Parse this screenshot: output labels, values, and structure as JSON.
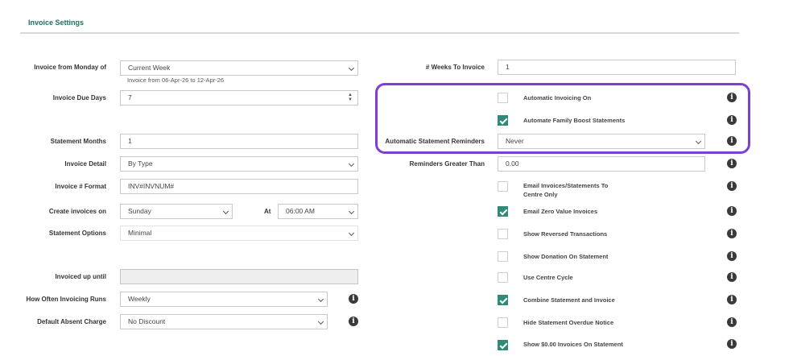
{
  "section": {
    "title": "Invoice Settings"
  },
  "left": {
    "invoice_from_label": "Invoice from Monday of",
    "invoice_from_value": "Current Week",
    "invoice_from_hint": "Invoice from 06-Apr-26 to 12-Apr-26",
    "due_days_label": "Invoice Due Days",
    "due_days_value": "7",
    "statement_months_label": "Statement Months",
    "statement_months_value": "1",
    "invoice_detail_label": "Invoice Detail",
    "invoice_detail_value": "By Type",
    "invoice_format_label": "Invoice # Format",
    "invoice_format_value": "INV#INVNUM#",
    "create_on_label": "Create invoices on",
    "create_on_value": "Sunday",
    "at_label": "At",
    "at_value": "06:00 AM",
    "statement_options_label": "Statement Options",
    "statement_options_value": "Minimal",
    "invoiced_upto_label": "Invoiced up until",
    "invoiced_upto_value": "",
    "how_often_label": "How Often Invoicing Runs",
    "how_often_value": "Weekly",
    "absent_charge_label": "Default Absent Charge",
    "absent_charge_value": "No Discount"
  },
  "right": {
    "weeks_label": "# Weeks To Invoice",
    "weeks_value": "1",
    "reminders_label": "Automatic Statement Reminders",
    "reminders_value": "Never",
    "reminders_gt_label": "Reminders Greater Than",
    "reminders_gt_value": "0.00",
    "checkboxes": [
      {
        "label": "Automatic Invoicing On",
        "checked": false
      },
      {
        "label": "Automate Family Boost Statements",
        "checked": true
      },
      {
        "label": "Email Invoices/Statements To Centre Only",
        "checked": false
      },
      {
        "label": "Email Zero Value Invoices",
        "checked": true
      },
      {
        "label": "Show Reversed Transactions",
        "checked": false
      },
      {
        "label": "Show Donation On Statement",
        "checked": false
      },
      {
        "label": "Use Centre Cycle",
        "checked": false
      },
      {
        "label": "Combine Statement and Invoice",
        "checked": true
      },
      {
        "label": "Hide Statement Overdue Notice",
        "checked": false
      },
      {
        "label": "Show $0.00 Invoices On Statement",
        "checked": true
      }
    ]
  },
  "icons": {
    "info": "i",
    "check_color": "#2f8a79",
    "highlight_color": "#7b3fd6"
  }
}
